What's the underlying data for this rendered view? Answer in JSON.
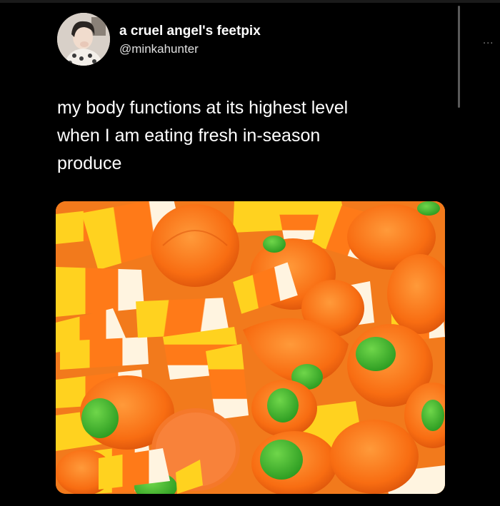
{
  "tweet": {
    "author": {
      "display_name": "a cruel angel's feetpix",
      "handle": "@minkahunter",
      "avatar_icon": "profile-photo"
    },
    "more_icon": "more-options-icon",
    "more_label": "...",
    "text_lines": [
      "my body functions at its highest level",
      "when I am eating fresh in-season",
      "produce"
    ],
    "media": {
      "icon": "photo-candy-corn-and-pumpkins"
    }
  },
  "colors": {
    "background": "#000000",
    "text": "#ffffff",
    "handle": "#e0e0e0",
    "candy_orange": "#ff7a18",
    "candy_yellow": "#ffd21f",
    "candy_white": "#fff4e0",
    "stem_green": "#3ab52a"
  }
}
